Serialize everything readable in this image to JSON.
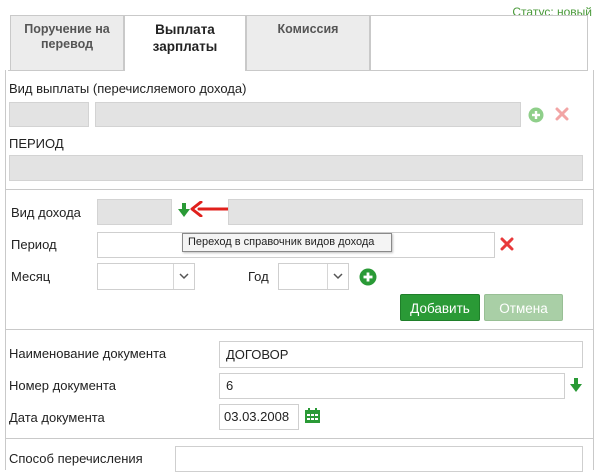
{
  "status": "Статус: новый",
  "tabs": [
    {
      "line1": "Поручение на",
      "line2": "перевод"
    },
    {
      "line1": "Выплата",
      "line2": "зарплаты"
    },
    {
      "line1": "Комиссия",
      "line2": ""
    }
  ],
  "payout": {
    "label": "Вид выплаты (перечисляемого дохода)",
    "code_value": "",
    "name_value": ""
  },
  "period_section": {
    "label": "ПЕРИОД",
    "value": ""
  },
  "income": {
    "type_label": "Вид дохода",
    "code_value": "",
    "name_value": "",
    "tooltip": "Переход в справочник видов дохода",
    "period_label": "Период",
    "period_value": "",
    "month_label": "Месяц",
    "month_value": "",
    "year_label": "Год",
    "year_value": ""
  },
  "buttons": {
    "add": "Добавить",
    "cancel": "Отмена"
  },
  "document": {
    "name_label": "Наименование документа",
    "name_value": "ДОГОВОР",
    "number_label": "Номер документа",
    "number_value": "6",
    "date_label": "Дата документа",
    "date_value": "03.03.2008",
    "transfer_label": "Способ перечисления"
  },
  "colors": {
    "accent_green": "#2a9a36",
    "delete_red": "#e8393a",
    "status_green": "#4a9a3a",
    "annotation_arrow": "#e0201c"
  },
  "icons": [
    "plus-circle-icon",
    "close-icon",
    "arrow-down-icon",
    "calendar-icon",
    "chevron-down-icon",
    "annotation-arrow-icon"
  ]
}
